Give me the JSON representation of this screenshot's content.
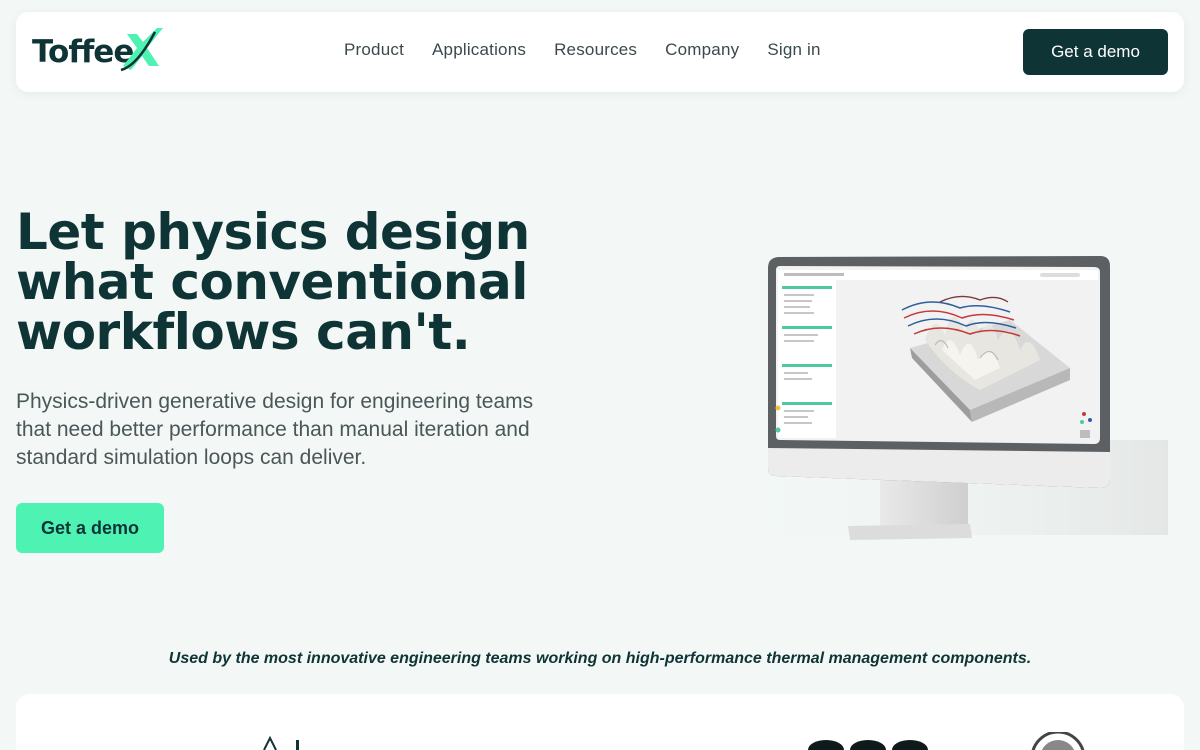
{
  "brand": {
    "name": "Toffee",
    "accent": "#4ef2b3",
    "dark": "#0f3436"
  },
  "nav": {
    "items": [
      {
        "label": "Product"
      },
      {
        "label": "Applications"
      },
      {
        "label": "Resources"
      },
      {
        "label": "Company"
      },
      {
        "label": "Sign in"
      }
    ],
    "cta_label": "Get a demo"
  },
  "hero": {
    "title_lines": [
      "Let physics design",
      "what conventional",
      "workflows can't."
    ],
    "subtitle_lines": [
      "Physics-driven generative design for engineering teams",
      "that need better performance than manual iteration and",
      "standard simulation loops can deliver."
    ],
    "cta_label": "Get a demo"
  },
  "social_proof": {
    "tagline": "Used by the most innovative engineering teams working on high-performance thermal management components."
  }
}
